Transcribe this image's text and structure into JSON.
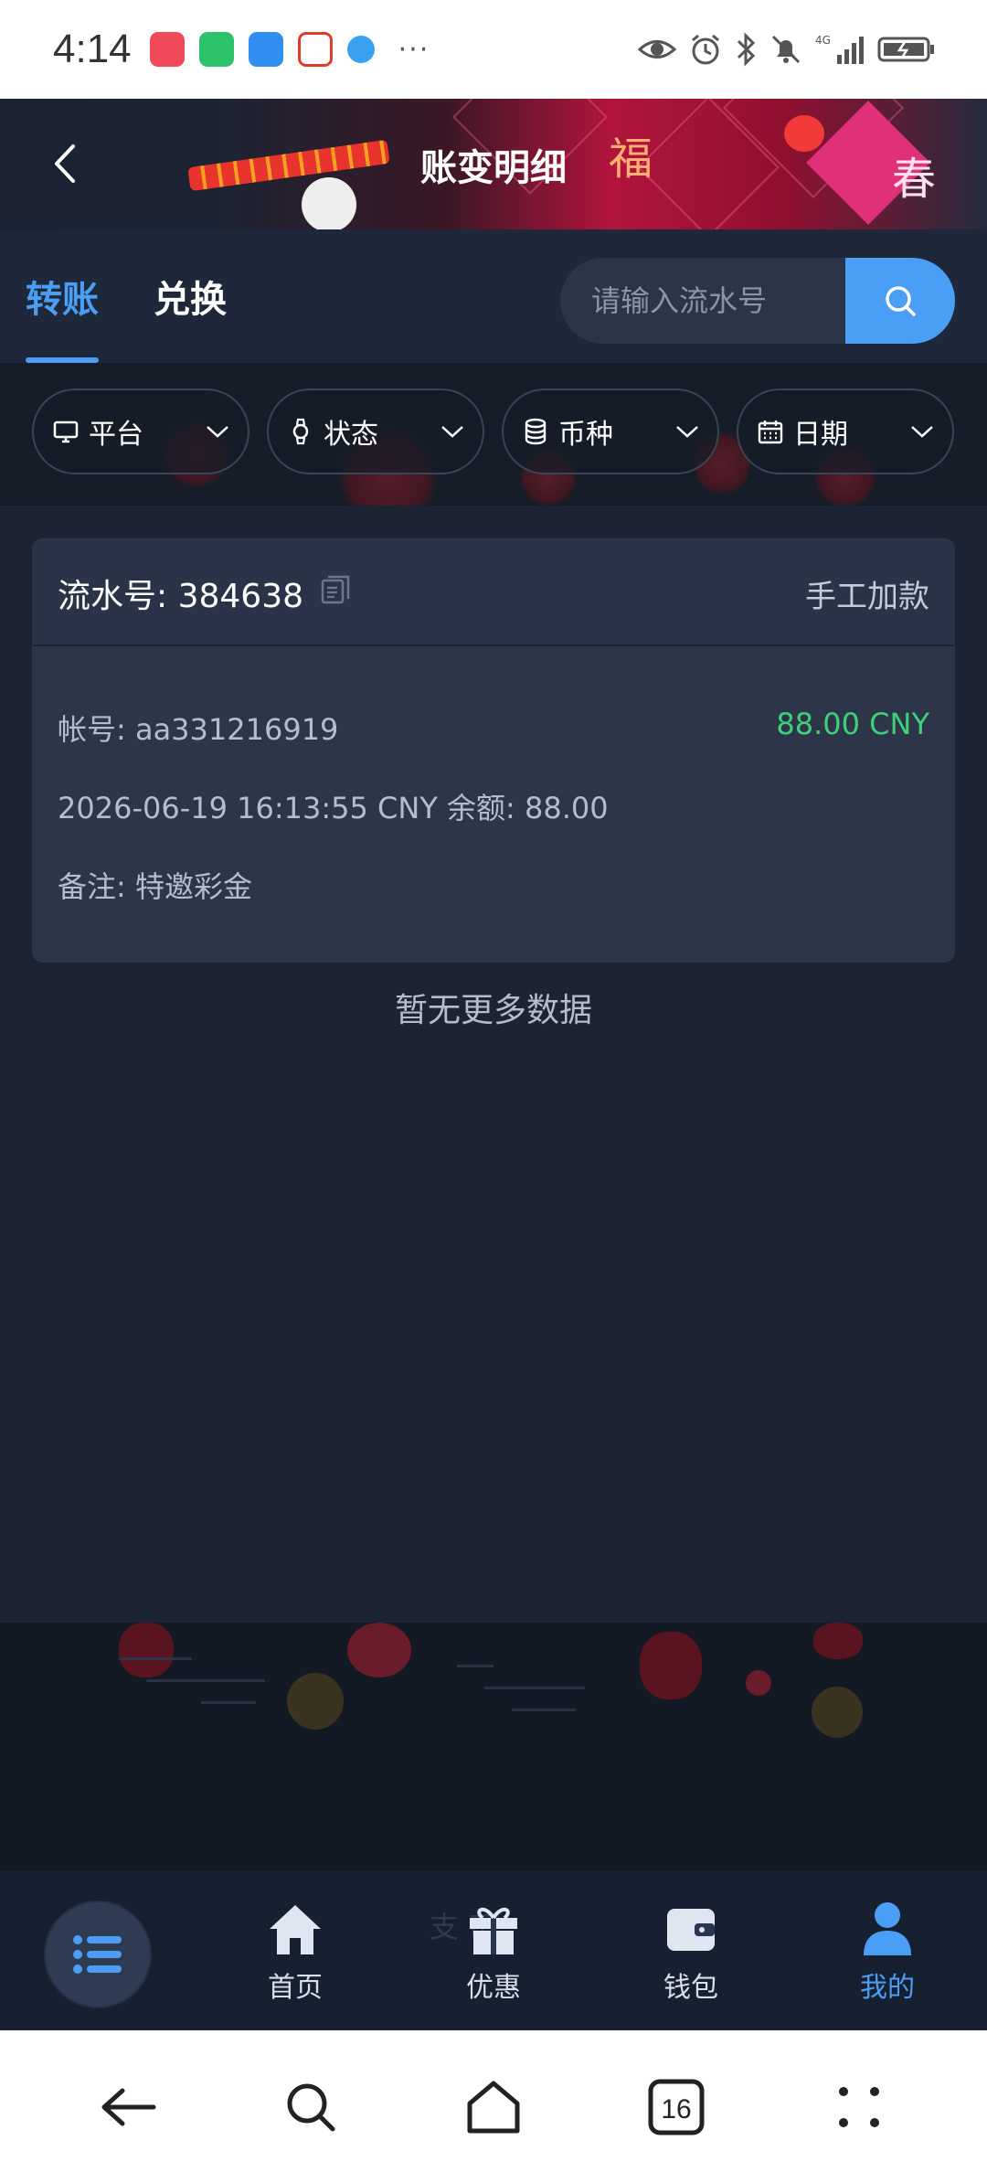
{
  "status_bar": {
    "time": "4:14",
    "dots": "···",
    "apps": [
      "red-bag-app-icon",
      "wechat-app-icon",
      "message-app-icon",
      "weather-app-icon",
      "browser-app-icon"
    ]
  },
  "header": {
    "title": "账变明细",
    "deco_fu": "福",
    "deco_chun": "春"
  },
  "tabs": [
    {
      "label": "转账",
      "active": true
    },
    {
      "label": "兑换",
      "active": false
    }
  ],
  "search": {
    "placeholder": "请输入流水号"
  },
  "filters": [
    {
      "label": "平台",
      "icon": "monitor-icon"
    },
    {
      "label": "状态",
      "icon": "watch-icon"
    },
    {
      "label": "币种",
      "icon": "database-icon"
    },
    {
      "label": "日期",
      "icon": "calendar-icon"
    }
  ],
  "record": {
    "serial": "流水号: 384638",
    "type": "手工加款",
    "account": "帐号: aa331216919",
    "amount": "88.00 CNY",
    "detail": "2026-06-19 16:13:55 CNY 余额: 88.00",
    "note": "备注: 特邀彩金"
  },
  "no_more": "暂无更多数据",
  "bottom_nav": {
    "ghost_text": "支 币",
    "items": [
      {
        "label": "首页",
        "icon": "home-icon",
        "active": false
      },
      {
        "label": "优惠",
        "icon": "gift-icon",
        "active": false
      },
      {
        "label": "钱包",
        "icon": "wallet-icon",
        "active": false
      },
      {
        "label": "我的",
        "icon": "user-icon",
        "active": true
      }
    ]
  },
  "system_nav": {
    "tabs_count": "16"
  },
  "colors": {
    "accent": "#4a9ef5",
    "amount_green": "#3fcf7a",
    "background": "#1c2433",
    "card": "#2d3549"
  }
}
